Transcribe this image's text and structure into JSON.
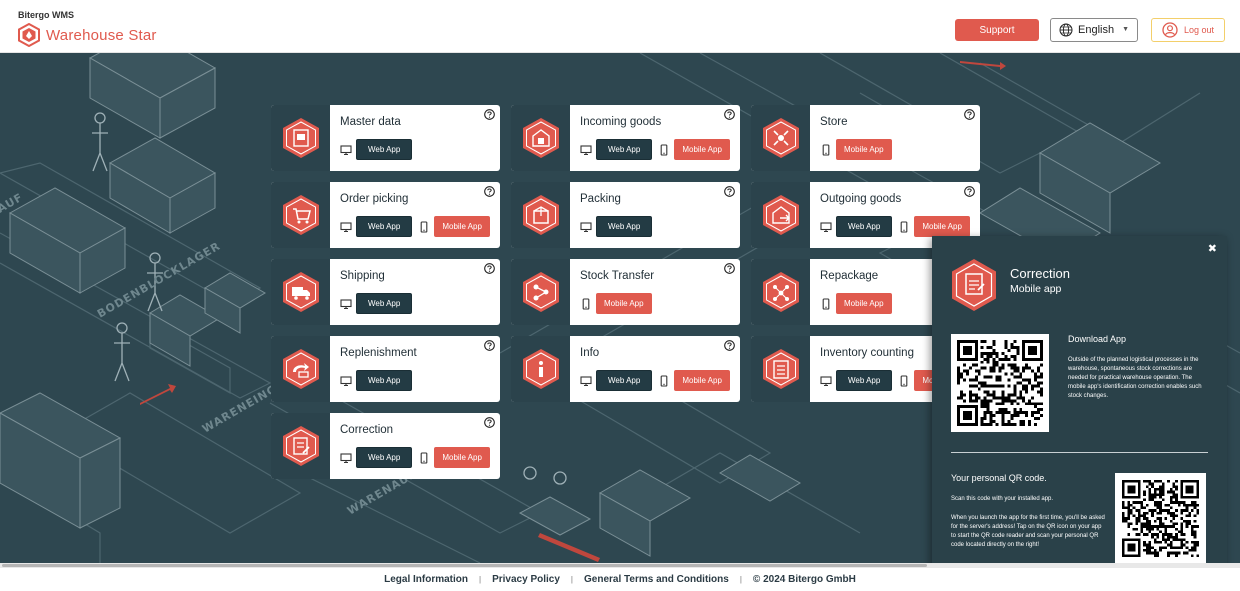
{
  "header": {
    "brand_top": "Bitergo WMS",
    "brand_name": "Warehouse Star",
    "support_label": "Support",
    "language": "English",
    "logout_label": "Log out"
  },
  "cards": [
    {
      "title": "Master data",
      "web": "Web App",
      "mobile": null,
      "icon": "master-data-icon"
    },
    {
      "title": "Incoming goods",
      "web": "Web App",
      "mobile": "Mobile App",
      "icon": "incoming-goods-icon"
    },
    {
      "title": "Store",
      "web": null,
      "mobile": "Mobile App",
      "icon": "store-icon"
    },
    {
      "title": "Order picking",
      "web": "Web App",
      "mobile": "Mobile App",
      "icon": "cart-icon"
    },
    {
      "title": "Packing",
      "web": "Web App",
      "mobile": null,
      "icon": "packing-icon"
    },
    {
      "title": "Outgoing goods",
      "web": "Web App",
      "mobile": "Mobile App",
      "icon": "outgoing-goods-icon"
    },
    {
      "title": "Shipping",
      "web": "Web App",
      "mobile": null,
      "icon": "truck-icon"
    },
    {
      "title": "Stock Transfer",
      "web": null,
      "mobile": "Mobile App",
      "icon": "transfer-icon"
    },
    {
      "title": "Repackage",
      "web": null,
      "mobile": "Mobile App",
      "icon": "repackage-icon"
    },
    {
      "title": "Replenishment",
      "web": "Web App",
      "mobile": null,
      "icon": "replenishment-icon"
    },
    {
      "title": "Info",
      "web": "Web App",
      "mobile": "Mobile App",
      "icon": "info-icon"
    },
    {
      "title": "Inventory counting",
      "web": "Web App",
      "mobile": "Mobi",
      "icon": "inventory-icon"
    },
    {
      "title": "Correction",
      "web": "Web App",
      "mobile": "Mobile App",
      "icon": "correction-icon"
    }
  ],
  "panel": {
    "close": "✖",
    "title": "Correction",
    "subtitle": "Mobile app",
    "download_title": "Download App",
    "download_text": "Outside of the planned logistical processes in the warehouse, spontaneous stock corrections are needed for practical warehouse operation. The mobile app's identification correction enables such stock changes.",
    "personal_title": "Your personal QR code.",
    "personal_text1": "Scan this code with your installed app.",
    "personal_text2": "When you launch the app for the first time, you'll be asked for the server's address! Tap on the QR icon on your app to start the QR code reader and scan your personal QR code located directly on the right!"
  },
  "footer": {
    "legal": "Legal Information",
    "privacy": "Privacy Policy",
    "terms": "General Terms and Conditions",
    "copyright": "© 2024 Bitergo GmbH",
    "separator": "|"
  },
  "background_text": [
    "BODENBLOCKLAGER",
    "WARENEING",
    "WARENAUS",
    "AUF"
  ],
  "colors": {
    "accent": "#e05a4e",
    "dark": "#2e4750",
    "button_dark": "#233b44"
  }
}
